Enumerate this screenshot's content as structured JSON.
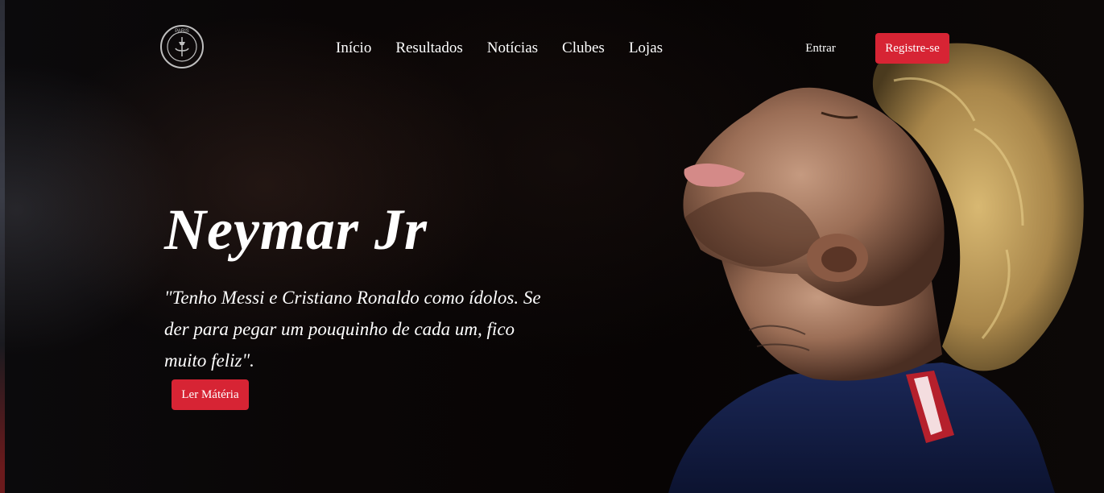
{
  "nav": {
    "logo_text": "PARIS",
    "links": [
      "Início",
      "Resultados",
      "Notícias",
      "Clubes",
      "Lojas"
    ],
    "login_label": "Entrar",
    "register_label": "Registre-se"
  },
  "hero": {
    "title": "Neymar Jr",
    "quote": "\"Tenho Messi e Cristiano Ronaldo como ídolos. Se der para pegar um pouquinho de cada um, fico muito feliz\".",
    "cta_label": "Ler Mátéria"
  },
  "colors": {
    "accent": "#d72434",
    "background": "#050303",
    "text": "#ffffff"
  }
}
